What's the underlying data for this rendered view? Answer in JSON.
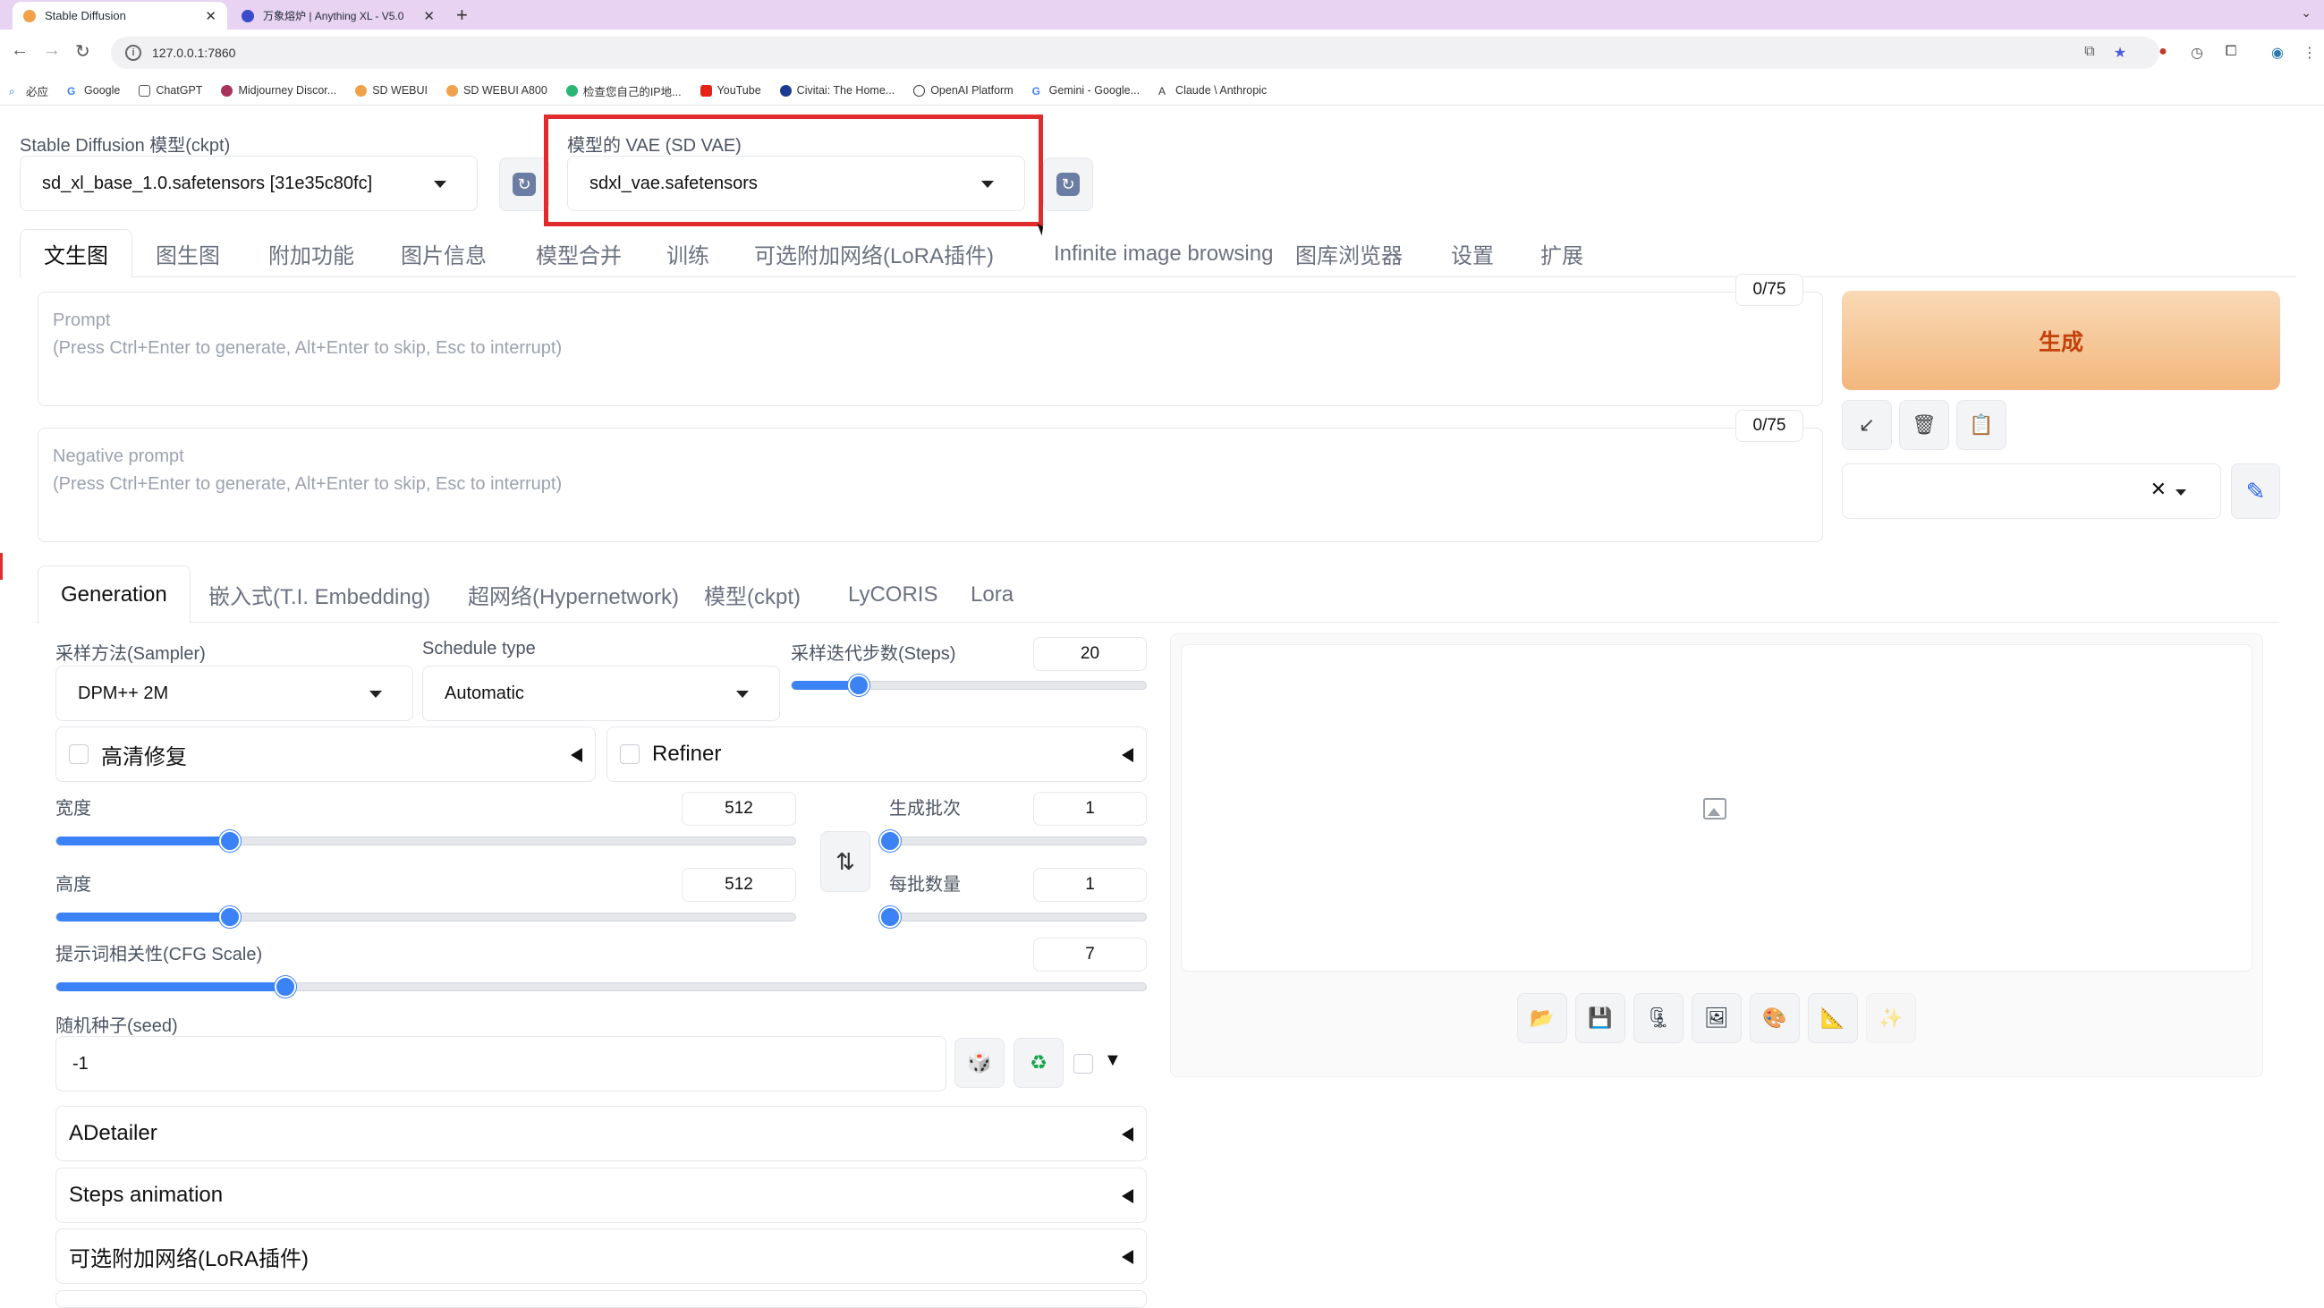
{
  "browser": {
    "tabs": [
      {
        "title": "Stable Diffusion",
        "active": true
      },
      {
        "title": "万象熔炉 | Anything XL - V5.0",
        "active": false
      }
    ],
    "url": "127.0.0.1:7860",
    "bookmarks": [
      "必应",
      "Google",
      "ChatGPT",
      "Midjourney Discor...",
      "SD WEBUI",
      "SD WEBUI A800",
      "检查您自己的IP地...",
      "YouTube",
      "Civitai: The Home...",
      "OpenAI Platform",
      "Gemini - Google...",
      "Claude \\ Anthropic"
    ]
  },
  "top": {
    "ckpt_label": "Stable Diffusion 模型(ckpt)",
    "ckpt_value": "sd_xl_base_1.0.safetensors [31e35c80fc]",
    "vae_label": "模型的 VAE (SD VAE)",
    "vae_value": "sdxl_vae.safetensors"
  },
  "main_tabs": [
    "文生图",
    "图生图",
    "附加功能",
    "图片信息",
    "模型合并",
    "训练",
    "可选附加网络(LoRA插件)",
    "Infinite image browsing",
    "图库浏览器",
    "设置",
    "扩展"
  ],
  "prompt": {
    "title": "Prompt",
    "hint": "(Press Ctrl+Enter to generate, Alt+Enter to skip, Esc to interrupt)",
    "counter": "0/75"
  },
  "negative": {
    "title": "Negative prompt",
    "hint": "(Press Ctrl+Enter to generate, Alt+Enter to skip, Esc to interrupt)",
    "counter": "0/75"
  },
  "generate_label": "生成",
  "sub_tabs": [
    "Generation",
    "嵌入式(T.I. Embedding)",
    "超网络(Hypernetwork)",
    "模型(ckpt)",
    "LyCORIS",
    "Lora"
  ],
  "gen": {
    "sampler_label": "采样方法(Sampler)",
    "sampler_value": "DPM++ 2M",
    "schedule_label": "Schedule type",
    "schedule_value": "Automatic",
    "steps_label": "采样迭代步数(Steps)",
    "steps_value": "20",
    "steps_fraction": 0.19,
    "hires_label": "高清修复",
    "refiner_label": "Refiner",
    "width_label": "宽度",
    "width_value": "512",
    "width_fraction": 0.235,
    "height_label": "高度",
    "height_value": "512",
    "height_fraction": 0.235,
    "batch_count_label": "生成批次",
    "batch_count_value": "1",
    "batch_count_fraction": 0.0,
    "batch_size_label": "每批数量",
    "batch_size_value": "1",
    "batch_size_fraction": 0.0,
    "cfg_label": "提示词相关性(CFG Scale)",
    "cfg_value": "7",
    "cfg_fraction": 0.21,
    "seed_label": "随机种子(seed)",
    "seed_value": "-1",
    "seed_extra": "▼",
    "accordions": [
      "ADetailer",
      "Steps animation",
      "可选附加网络(LoRA插件)"
    ]
  },
  "icons": {
    "send_to": "↙",
    "trash": "🗑",
    "clipboard": "📋",
    "clear": "✕",
    "pencil": "✎",
    "swap": "⇅",
    "dice": "🎲",
    "recycle": "♻",
    "image_tools": [
      "📂",
      "💾",
      "🗜",
      "🖼",
      "🎨",
      "📐",
      "✨"
    ]
  }
}
